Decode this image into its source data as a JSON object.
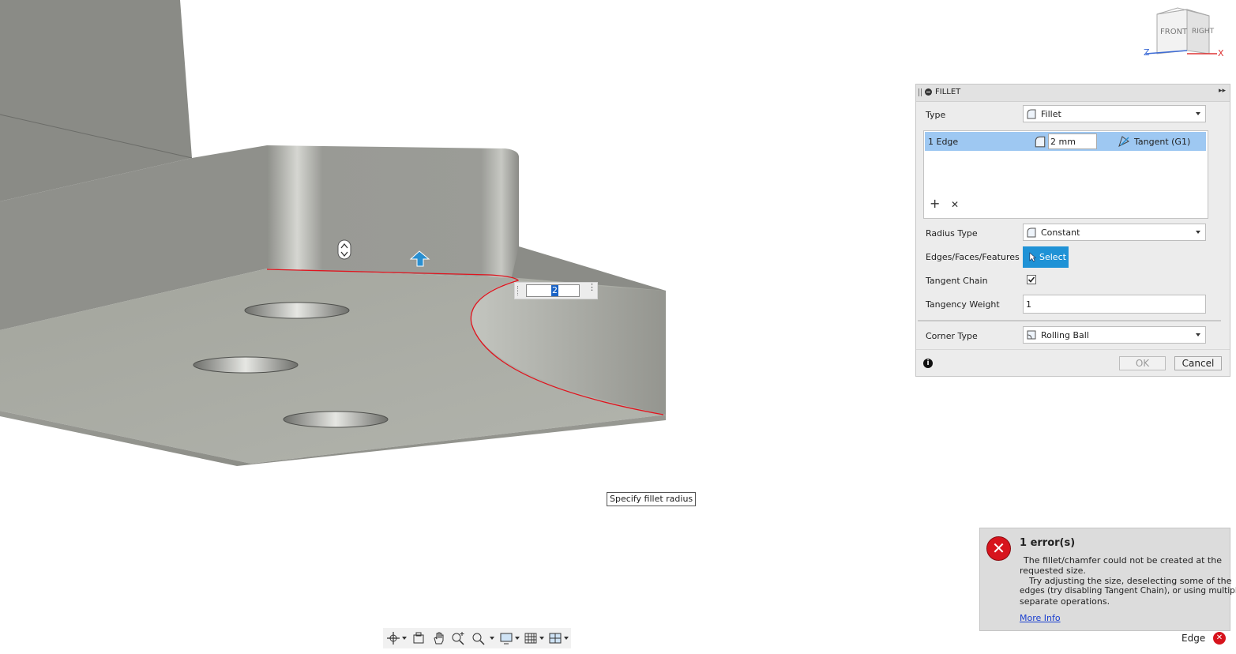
{
  "viewcube": {
    "front": "FRONT",
    "right": "RIGHT",
    "axis_z": "Z",
    "axis_x": "X"
  },
  "dimension_input": {
    "value": "2"
  },
  "tooltip": {
    "text": "Specify fillet radius"
  },
  "fillet": {
    "title": "FILLET",
    "type_label": "Type",
    "type_value": "Fillet",
    "edge_row": {
      "name": "1 Edge",
      "radius": "2 mm",
      "continuity": "Tangent (G1)"
    },
    "add_symbol": "+",
    "remove_symbol": "✕",
    "radius_type_label": "Radius Type",
    "radius_type_value": "Constant",
    "edges_label": "Edges/Faces/Features",
    "select_label": "Select",
    "tangent_chain_label": "Tangent Chain",
    "tangent_chain_checked": true,
    "tangency_weight_label": "Tangency Weight",
    "tangency_weight_value": "1",
    "corner_type_label": "Corner Type",
    "corner_type_value": "Rolling Ball",
    "ok_label": "OK",
    "cancel_label": "Cancel"
  },
  "error": {
    "title": "1 error(s)",
    "line1": "The fillet/chamfer could not be created at the",
    "line2": "requested size.",
    "line3": "Try adjusting the size, deselecting some of the",
    "line4": "edges (try disabling Tangent Chain), or using multiple",
    "line5": "separate operations.",
    "link": "More Info"
  },
  "status": {
    "selection": "Edge"
  },
  "colors": {
    "accent": "#1f92d6",
    "selection": "#9ec8f2",
    "error": "#d7141d",
    "edge_highlight": "#e0141e"
  },
  "toolbar_icons": [
    "orbit-icon",
    "look-at-icon",
    "pan-icon",
    "zoom-icon",
    "fit-icon",
    "display-settings-icon",
    "grid-icon",
    "viewports-icon"
  ]
}
